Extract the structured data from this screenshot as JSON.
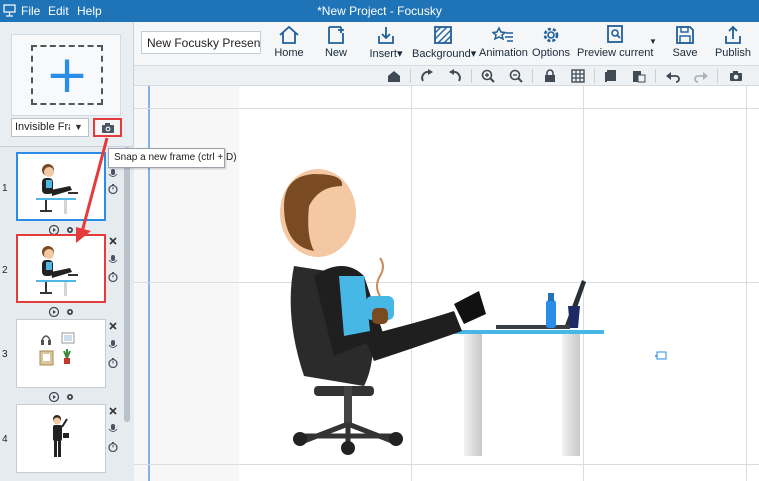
{
  "window": {
    "title": "*New Project - Focusky"
  },
  "menu": [
    "File",
    "Edit",
    "Help"
  ],
  "project": {
    "name": "New Focusky Presenta"
  },
  "toolbar": {
    "buttons": [
      {
        "label": "Home",
        "icon": "home-icon"
      },
      {
        "label": "New",
        "icon": "new-frame-icon"
      },
      {
        "label": "Insert▾",
        "icon": "insert-icon"
      },
      {
        "label": "Background▾",
        "icon": "background-icon"
      },
      {
        "label": "Animation",
        "icon": "animation-icon"
      },
      {
        "label": "Options",
        "icon": "gear-icon"
      },
      {
        "label": "Preview current",
        "icon": "preview-icon"
      },
      {
        "label": "Save",
        "icon": "save-icon"
      },
      {
        "label": "Publish",
        "icon": "publish-icon"
      }
    ]
  },
  "left": {
    "frame_type": "Invisible Fran",
    "snap_tooltip": "Snap a new frame (ctrl + D)",
    "frames": [
      {
        "number": "1"
      },
      {
        "number": "2"
      },
      {
        "number": "3"
      },
      {
        "number": "4"
      }
    ]
  },
  "colors": {
    "titlebar": "#1f73b7",
    "accent": "#2a8de8",
    "highlight": "#e43b3b"
  }
}
